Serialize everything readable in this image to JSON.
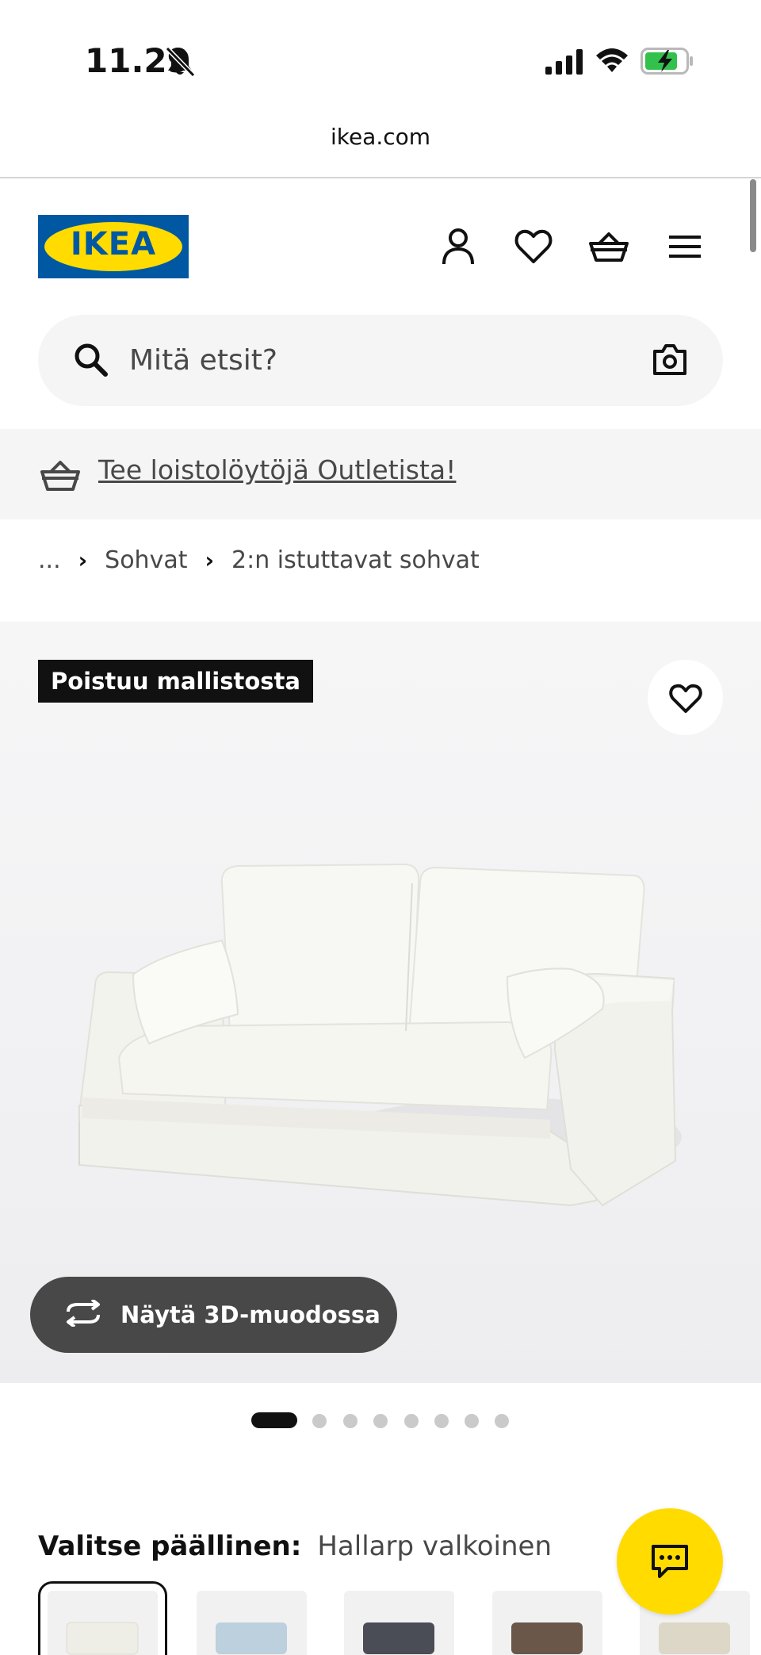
{
  "status_bar": {
    "time": "11.29",
    "url": "ikea.com"
  },
  "header": {
    "logo_text": "IKEA",
    "icons": [
      "account-icon",
      "heart-icon",
      "cart-icon",
      "menu-icon"
    ]
  },
  "search": {
    "placeholder": "Mitä etsit?"
  },
  "outlet": {
    "link_text": "Tee loistolöytöjä Outletista!"
  },
  "breadcrumb": {
    "ellipsis": "...",
    "items": [
      "Sohvat",
      "2:n istuttavat sohvat"
    ]
  },
  "product": {
    "badge": "Poistuu mallistosta",
    "view_3d_label": "Näytä 3D-muodossa",
    "image_count": 8,
    "active_image_index": 0
  },
  "cover": {
    "label": "Valitse päällinen:",
    "value": "Hallarp valkoinen",
    "swatch_colors": [
      "#efeee6",
      "#bcd0de",
      "#4a4d55",
      "#6b574a",
      "#ddd7c8"
    ]
  },
  "colors": {
    "ikea_blue": "#0058a3",
    "ikea_yellow": "#ffdb00",
    "text_dark": "#111111",
    "text_gray": "#484848",
    "panel_bg": "#f5f5f5"
  }
}
